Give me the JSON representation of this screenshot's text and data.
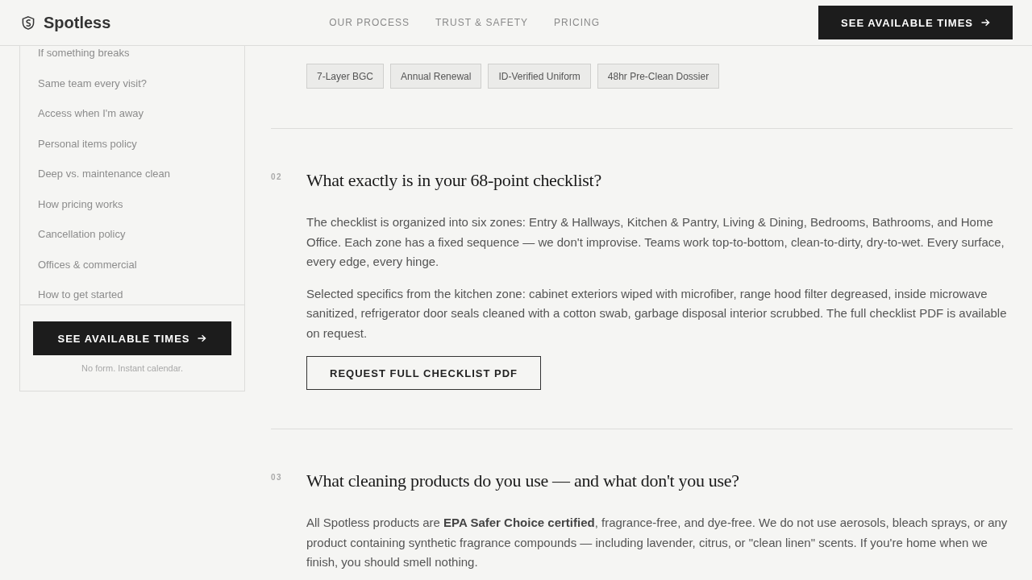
{
  "header": {
    "logo": "Spotless",
    "nav": [
      "OUR PROCESS",
      "TRUST & SAFETY",
      "PRICING"
    ],
    "cta": "SEE AVAILABLE TIMES"
  },
  "sidebar": {
    "items": [
      "If something breaks",
      "Same team every visit?",
      "Access when I'm away",
      "Personal items policy",
      "Deep vs. maintenance clean",
      "How pricing works",
      "Cancellation policy",
      "Offices & commercial",
      "How to get started"
    ],
    "cta": "SEE AVAILABLE TIMES",
    "note": "No form. Instant calendar."
  },
  "tags": [
    "7-Layer BGC",
    "Annual Renewal",
    "ID-Verified Uniform",
    "48hr Pre-Clean Dossier"
  ],
  "sections": [
    {
      "number": "02",
      "title": "What exactly is in your 68-point checklist?",
      "paragraphs": [
        "The checklist is organized into six zones: Entry & Hallways, Kitchen & Pantry, Living & Dining, Bedrooms, Bathrooms, and Home Office. Each zone has a fixed sequence — we don't improvise. Teams work top-to-bottom, clean-to-dirty, dry-to-wet. Every surface, every edge, every hinge.",
        "Selected specifics from the kitchen zone: cabinet exteriors wiped with microfiber, range hood filter degreased, inside microwave sanitized, refrigerator door seals cleaned with a cotton swab, garbage disposal interior scrubbed. The full checklist PDF is available on request."
      ],
      "button": "REQUEST FULL CHECKLIST PDF"
    },
    {
      "number": "03",
      "title": "What cleaning products do you use — and what don't you use?",
      "paragraphs": [
        "All Spotless products are **EPA Safer Choice certified**, fragrance-free, and dye-free. We do not use aerosols, bleach sprays, or any product containing synthetic fragrance compounds — including lavender, citrus, or \"clean linen\" scents. If you're home when we finish, you should smell nothing."
      ]
    }
  ]
}
